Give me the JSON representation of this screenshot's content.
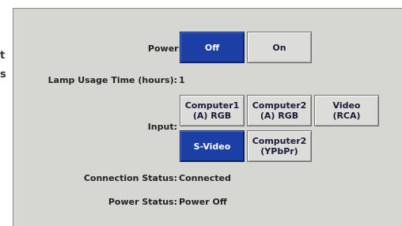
{
  "edge_fragments": [
    "t",
    "s"
  ],
  "power": {
    "label": "Power:",
    "off_label": "Off",
    "on_label": "On",
    "selected": "Off"
  },
  "lamp": {
    "label": "Lamp Usage Time (hours):",
    "value": "1"
  },
  "input": {
    "label": "Input:",
    "options": [
      "Computer1\n(A) RGB",
      "Computer2\n(A) RGB",
      "Video\n(RCA)",
      "S-Video",
      "Computer2\n(YPbPr)"
    ],
    "selected": "S-Video"
  },
  "connection_status": {
    "label": "Connection Status:",
    "value": "Connected"
  },
  "power_status": {
    "label": "Power Status:",
    "value": "Power Off"
  },
  "colors": {
    "panel": "#d6d6d2",
    "active_button": "#1c3fa6"
  }
}
